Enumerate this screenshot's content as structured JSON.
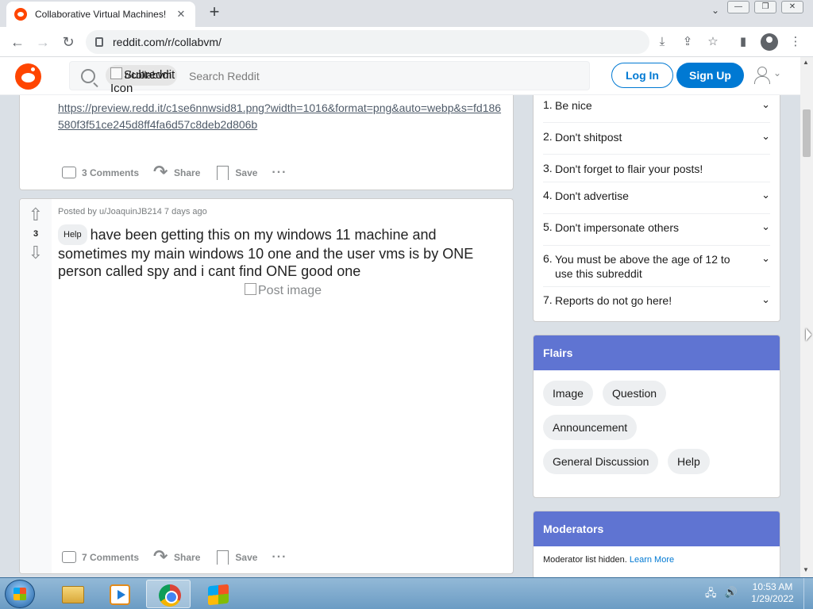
{
  "browser": {
    "tab_title": "Collaborative Virtual Machines!",
    "tab_close": "✕",
    "new_tab": "+",
    "url": "reddit.com/r/collabvm/"
  },
  "header": {
    "subreddit_chip": "r/collabvm",
    "subreddit_icon_alt": "Subreddit Icon",
    "search_placeholder": "Search Reddit",
    "login_label": "Log In",
    "signup_label": "Sign Up"
  },
  "post1": {
    "link": "https://preview.redd.it/c1se6nnwsid81.png?width=1016&format=png&auto=webp&s=fd186580f3f51ce245d8ff4fa6d57c8deb2d806b",
    "comments": "3 Comments",
    "share": "Share",
    "save": "Save",
    "more": "···"
  },
  "post2": {
    "votes": "3",
    "meta": "Posted by u/JoaquinJB214 7 days ago",
    "flair": "Help",
    "title": "have been getting this on my windows 11 machine and sometimes my main windows 10 one and the user vms is by ONE person called spy and i cant find ONE good one",
    "image_alt": "Post image",
    "comments": "7 Comments",
    "share": "Share",
    "save": "Save",
    "more": "···"
  },
  "rules": [
    {
      "num": "1.",
      "text": "Be nice"
    },
    {
      "num": "2.",
      "text": "Don't shitpost"
    },
    {
      "num": "3.",
      "text": "Don't forget to flair your posts!"
    },
    {
      "num": "4.",
      "text": "Don't advertise"
    },
    {
      "num": "5.",
      "text": "Don't impersonate others"
    },
    {
      "num": "6.",
      "text": "You must be above the age of 12 to use this subreddit"
    },
    {
      "num": "7.",
      "text": "Reports do not go here!"
    }
  ],
  "flairs": {
    "title": "Flairs",
    "items": [
      "Image",
      "Question",
      "Announcement",
      "General Discussion",
      "Help"
    ]
  },
  "moderators": {
    "title": "Moderators",
    "text": "Moderator list hidden.",
    "link": "Learn More"
  },
  "taskbar": {
    "time": "10:53 AM",
    "date": "1/29/2022"
  },
  "colors": {
    "reddit_orange": "#ff4500",
    "reddit_blue": "#0079d3",
    "card_header": "#5f74d2"
  },
  "icons": [
    "reddit-logo-icon",
    "search-icon",
    "user-icon",
    "comment-icon",
    "share-icon",
    "save-icon",
    "upvote-icon",
    "downvote-icon",
    "chevron-down-icon"
  ]
}
